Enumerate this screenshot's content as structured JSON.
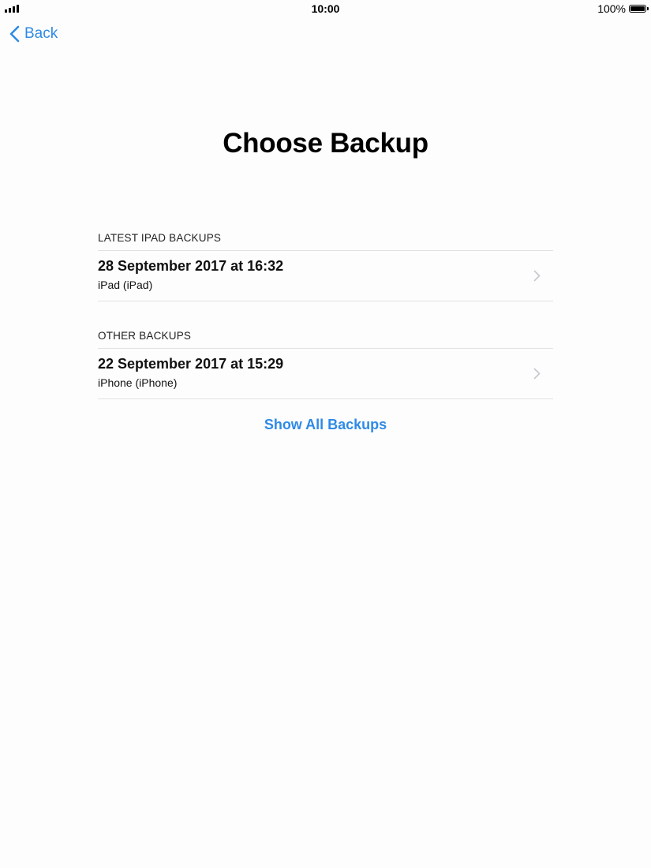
{
  "status_bar": {
    "time": "10:00",
    "battery_percent": "100%",
    "signal_icon": "signal-bars-icon",
    "battery_icon": "battery-full-icon"
  },
  "nav": {
    "back_label": "Back",
    "back_icon": "chevron-left-icon"
  },
  "page": {
    "title": "Choose Backup"
  },
  "sections": [
    {
      "header": "LATEST IPAD BACKUPS",
      "items": [
        {
          "title": "28 September 2017 at 16:32",
          "subtitle": "iPad (iPad)"
        }
      ]
    },
    {
      "header": "OTHER BACKUPS",
      "items": [
        {
          "title": "22 September 2017 at 15:29",
          "subtitle": "iPhone (iPhone)"
        }
      ]
    }
  ],
  "actions": {
    "show_all_label": "Show All Backups"
  },
  "colors": {
    "accent": "#2f8ae6",
    "background": "#fdfdfd",
    "separator": "#e2e2e2",
    "chevron": "#c7c7cc"
  }
}
